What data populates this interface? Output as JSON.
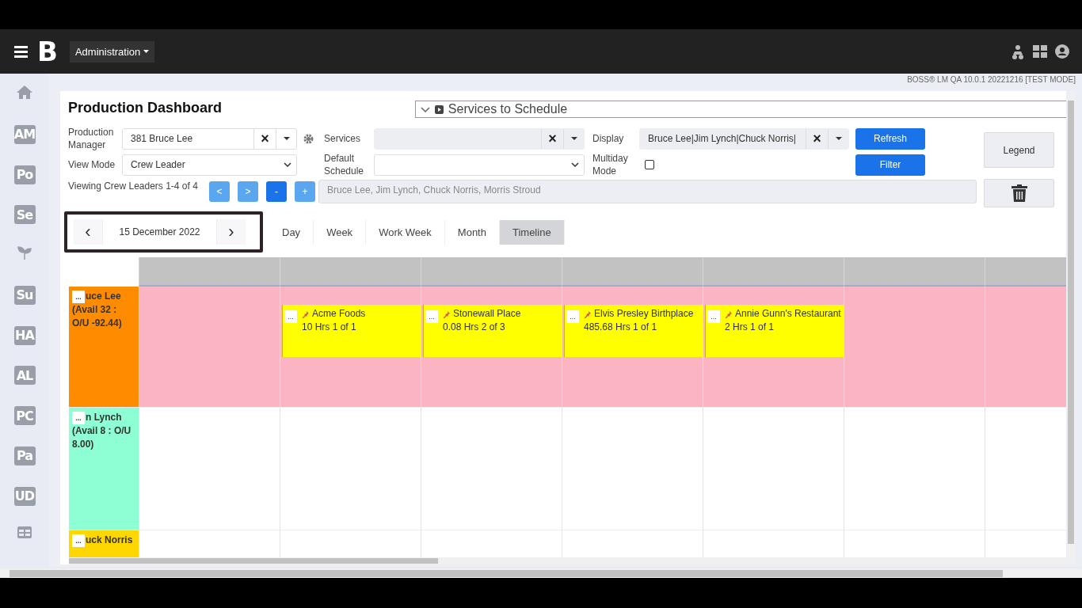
{
  "header": {
    "brand": "B",
    "menu": "Administration"
  },
  "version": "BOSS® LM QA 10.0.1 20221216 [TEST MODE]",
  "sidebar": {
    "items": [
      {
        "kind": "icon"
      },
      {
        "kind": "text",
        "label": "AM"
      },
      {
        "kind": "text",
        "label": "Po"
      },
      {
        "kind": "text",
        "label": "Se"
      },
      {
        "kind": "icon"
      },
      {
        "kind": "text",
        "label": "Su"
      },
      {
        "kind": "text",
        "label": "HA"
      },
      {
        "kind": "text",
        "label": "AL"
      },
      {
        "kind": "text",
        "label": "PC"
      },
      {
        "kind": "text",
        "label": "Pa"
      },
      {
        "kind": "text",
        "label": "UD"
      },
      {
        "kind": "icon"
      }
    ]
  },
  "title": "Production Dashboard",
  "services_panel": {
    "label": "Services to Schedule",
    "expanded": false
  },
  "form": {
    "production_manager": {
      "label": "Production Manager",
      "value": "381 Bruce Lee"
    },
    "view_mode": {
      "label": "View Mode",
      "value": "Crew Leader"
    },
    "services": {
      "label": "Services"
    },
    "default_schedule": {
      "label": "Default Schedule"
    },
    "display": {
      "label": "Display",
      "value": "Bruce Lee|Jim Lynch|Chuck Norris|"
    },
    "multiday_mode": {
      "label": "Multiday Mode",
      "checked": false
    },
    "viewing": "Viewing Crew Leaders 1-4 of 4",
    "nav_buttons": [
      {
        "label": "<",
        "selected": false
      },
      {
        "label": ">",
        "selected": false
      },
      {
        "label": "-",
        "selected": true
      },
      {
        "label": "+",
        "selected": false
      }
    ],
    "crew_list": "Bruce Lee, Jim Lynch, Chuck Norris, Morris Stroud"
  },
  "buttons": {
    "clear": "×",
    "refresh": "Refresh",
    "filter": "Filter",
    "legend": "Legend"
  },
  "date_nav": {
    "prev": "‹",
    "date": "15 December 2022",
    "next": "›"
  },
  "views": [
    {
      "label": "Day",
      "selected": false
    },
    {
      "label": "Week",
      "selected": false
    },
    {
      "label": "Work Week",
      "selected": false
    },
    {
      "label": "Month",
      "selected": false
    },
    {
      "label": "Timeline",
      "selected": true
    }
  ],
  "crews": [
    {
      "name": "uce Lee",
      "detail": "(Avail 32 : O/U -92.44)",
      "color": "#ff8c00",
      "overbooked": true,
      "more": "...",
      "cells": [
        {},
        {
          "event": {
            "title": "Acme Foods",
            "detail": "10 Hrs 1 of 1",
            "more": "..."
          }
        },
        {
          "event": {
            "title": "Stonewall Place",
            "detail": "0.08 Hrs 2 of 3",
            "more": "..."
          }
        },
        {
          "event": {
            "title": "Elvis Presley Birthplace",
            "detail": "485.68 Hrs 1 of 1",
            "more": "..."
          }
        },
        {
          "event": {
            "title": "Annie Gunn's Restaurant",
            "detail": "2 Hrs 1 of 1",
            "more": "..."
          }
        },
        {},
        {}
      ]
    },
    {
      "name": "n Lynch",
      "detail": "(Avail 8 : O/U 8.00)",
      "color": "#8effd4",
      "overbooked": false,
      "more": "...",
      "cells": [
        {},
        {},
        {},
        {},
        {},
        {},
        {}
      ]
    },
    {
      "name": "uck Norris",
      "color": "#ffd700",
      "overbooked": false,
      "more": "...",
      "cells": [
        {},
        {},
        {},
        {},
        {},
        {},
        {}
      ]
    }
  ]
}
